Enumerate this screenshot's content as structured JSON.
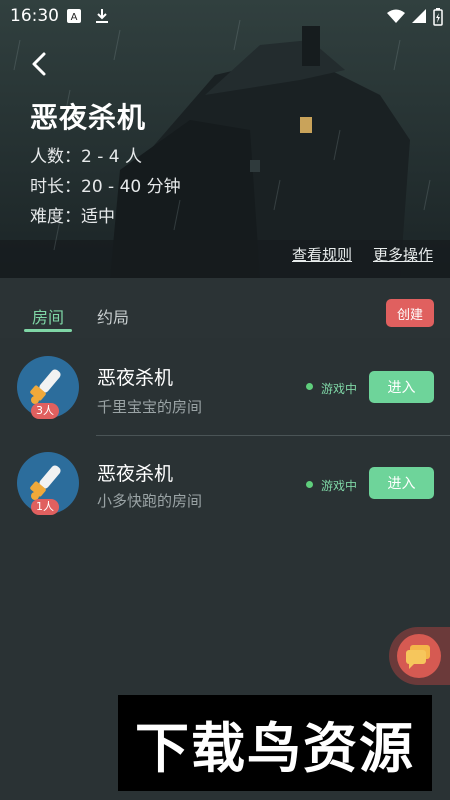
{
  "status_bar": {
    "time": "16:30"
  },
  "game": {
    "title": "恶夜杀机",
    "players": "人数：2 - 4 人",
    "duration": "时长：20 - 40 分钟",
    "difficulty": "难度：适中",
    "view_rules": "查看规则",
    "more_actions": "更多操作"
  },
  "tabs": {
    "rooms": "房间",
    "appointments": "约局"
  },
  "create_label": "创建",
  "rooms": [
    {
      "name": "恶夜杀机",
      "owner": "千里宝宝的房间",
      "count": "3人",
      "status": "游戏中",
      "enter": "进入"
    },
    {
      "name": "恶夜杀机",
      "owner": "小多快跑的房间",
      "count": "1人",
      "status": "游戏中",
      "enter": "进入"
    }
  ],
  "watermark": "下载鸟资源",
  "colors": {
    "accent_green": "#7fd6a6",
    "enter_button": "#6ed49a",
    "create_button": "#e0605f",
    "badge": "#e0605f"
  },
  "icons": {
    "back": "chevron-left-icon",
    "chat": "chat-bubble-icon",
    "room_avatar": "chainsaw-icon"
  }
}
